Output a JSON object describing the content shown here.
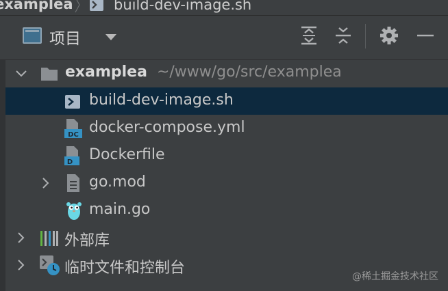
{
  "breadcrumb": {
    "root": "examplea",
    "file": "build-dev-image.sh"
  },
  "toolbar": {
    "title": "项目",
    "icons": [
      "expand-all-icon",
      "collapse-all-icon",
      "gear-icon",
      "minimize-icon"
    ]
  },
  "tree": {
    "project": {
      "name": "examplea",
      "path": "~/www/go/src/examplea"
    },
    "files": [
      {
        "label": "build-dev-image.sh",
        "icon": "shell-script-icon",
        "selected": true
      },
      {
        "label": "docker-compose.yml",
        "icon": "docker-compose-icon",
        "selected": false
      },
      {
        "label": "Dockerfile",
        "icon": "dockerfile-icon",
        "selected": false
      },
      {
        "label": "go.mod",
        "icon": "gomod-file-icon",
        "selected": false
      },
      {
        "label": "main.go",
        "icon": "go-gopher-icon",
        "selected": false
      }
    ],
    "external_libraries": "外部库",
    "scratches": "临时文件和控制台"
  },
  "colors": {
    "background": "#3c3f41",
    "selection": "#0d293e",
    "text": "#c8c8c8",
    "path_text": "#8f8f8f"
  },
  "watermark": "@稀土掘金技术社区"
}
